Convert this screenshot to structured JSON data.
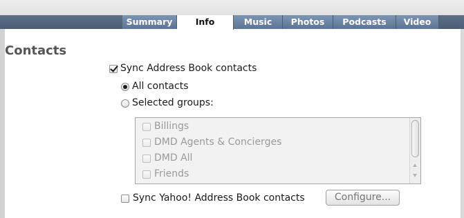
{
  "tabs": [
    {
      "label": "Summary",
      "active": false
    },
    {
      "label": "Info",
      "active": true
    },
    {
      "label": "Music",
      "active": false
    },
    {
      "label": "Photos",
      "active": false
    },
    {
      "label": "Podcasts",
      "active": false
    },
    {
      "label": "Video",
      "active": false
    }
  ],
  "contacts": {
    "title": "Contacts",
    "sync_address_book": {
      "label": "Sync Address Book contacts",
      "checked": true
    },
    "all_contacts": {
      "label": "All contacts",
      "selected": true
    },
    "selected_groups": {
      "label": "Selected groups:",
      "selected": false,
      "groups": [
        {
          "label": "Billings",
          "checked": false
        },
        {
          "label": "DMD Agents & Concierges",
          "checked": false
        },
        {
          "label": "DMD All",
          "checked": false
        },
        {
          "label": "Friends",
          "checked": false
        }
      ]
    },
    "sync_yahoo": {
      "label": "Sync Yahoo! Address Book contacts",
      "checked": false
    },
    "configure_button": "Configure..."
  },
  "colors": {
    "tab_bar": "#5b6f87",
    "tab_active_bg": "#ffffff",
    "section_title": "#555555",
    "disabled_text": "#9a9a9a"
  }
}
